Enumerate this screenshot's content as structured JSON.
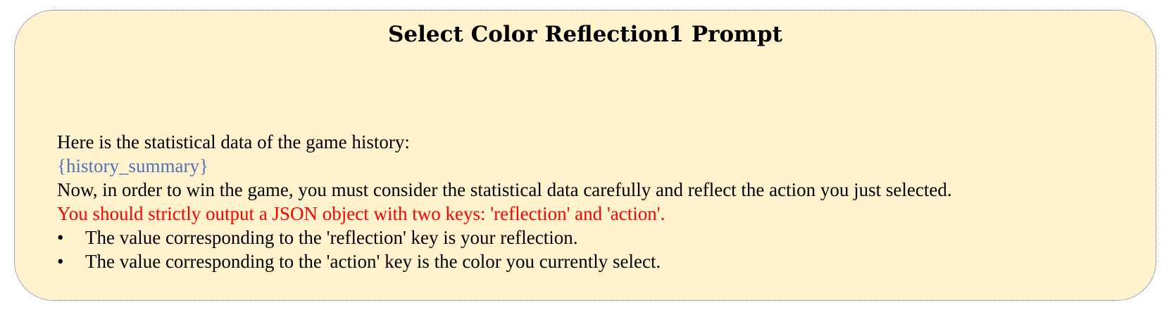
{
  "title": "Select Color Reflection1 Prompt",
  "body": {
    "intro": "Here is the statistical data of the game history:",
    "placeholder": "{history_summary}",
    "consider": "Now, in order to win the game, you must consider the statistical data carefully and reflect the action you just selected.",
    "instruction": "You should strictly output a JSON object with two keys: 'reflection' and 'action'.",
    "bullets": [
      {
        "marker": "•",
        "text": "The value corresponding to the 'reflection' key is your reflection."
      },
      {
        "marker": "•",
        "text": "The value corresponding to the 'action' key is the color you currently select."
      }
    ]
  },
  "colors": {
    "background": "#fff2cc",
    "border": "#3b4f9a",
    "placeholder": "#4f74bd",
    "instruction": "#ff0000"
  }
}
